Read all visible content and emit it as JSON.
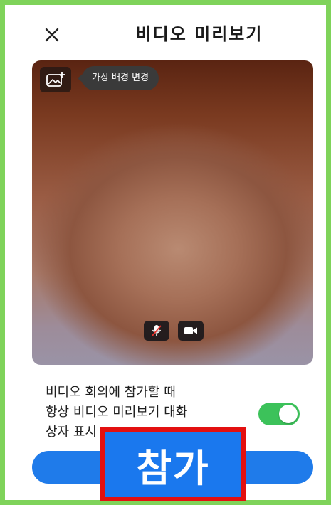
{
  "header": {
    "title": "비디오 미리보기",
    "close_icon": "close-icon"
  },
  "preview": {
    "virtual_background_icon": "image-add-icon",
    "tooltip": "가상 배경 변경",
    "mic_icon": "microphone-muted-icon",
    "camera_icon": "video-camera-icon"
  },
  "setting": {
    "line1": "비디오 회의에 참가할 때",
    "line2": "항상 비디오 미리보기 대화",
    "line3": "상자 표시",
    "toggle_on": true
  },
  "join": {
    "label": "참가"
  },
  "colors": {
    "frame": "#7fd35a",
    "toggle": "#3cc25a",
    "button": "#1f7bea",
    "highlight_border": "#e31010"
  }
}
